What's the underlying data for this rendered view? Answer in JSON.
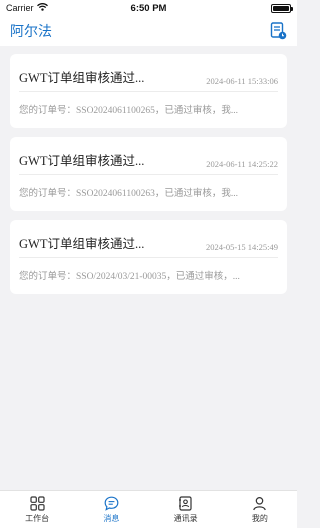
{
  "status_bar": {
    "carrier": "Carrier",
    "time": "6:50 PM",
    "battery_level": 1.0
  },
  "header": {
    "title": "阿尔法",
    "action_icon": "document-clock-icon"
  },
  "messages": [
    {
      "title": "GWT订单组审核通过...",
      "time": "2024-06-11 15:33:06",
      "body": "您的订单号：SSO2024061100265，已通过审核，我..."
    },
    {
      "title": "GWT订单组审核通过...",
      "time": "2024-06-11 14:25:22",
      "body": "您的订单号：SSO2024061100263，已通过审核，我..."
    },
    {
      "title": "GWT订单组审核通过...",
      "time": "2024-05-15 14:25:49",
      "body": "您的订单号：SSO/2024/03/21-00035，已通过审核，..."
    }
  ],
  "tabbar": {
    "active": "messages",
    "colors": {
      "active": "#1a73c8",
      "inactive": "#333333"
    },
    "items": [
      {
        "label": "工作台",
        "icon": "grid-icon"
      },
      {
        "label": "消息",
        "icon": "chat-bubble-icon"
      },
      {
        "label": "通讯录",
        "icon": "contacts-book-icon"
      },
      {
        "label": "我的",
        "icon": "person-icon"
      }
    ]
  }
}
